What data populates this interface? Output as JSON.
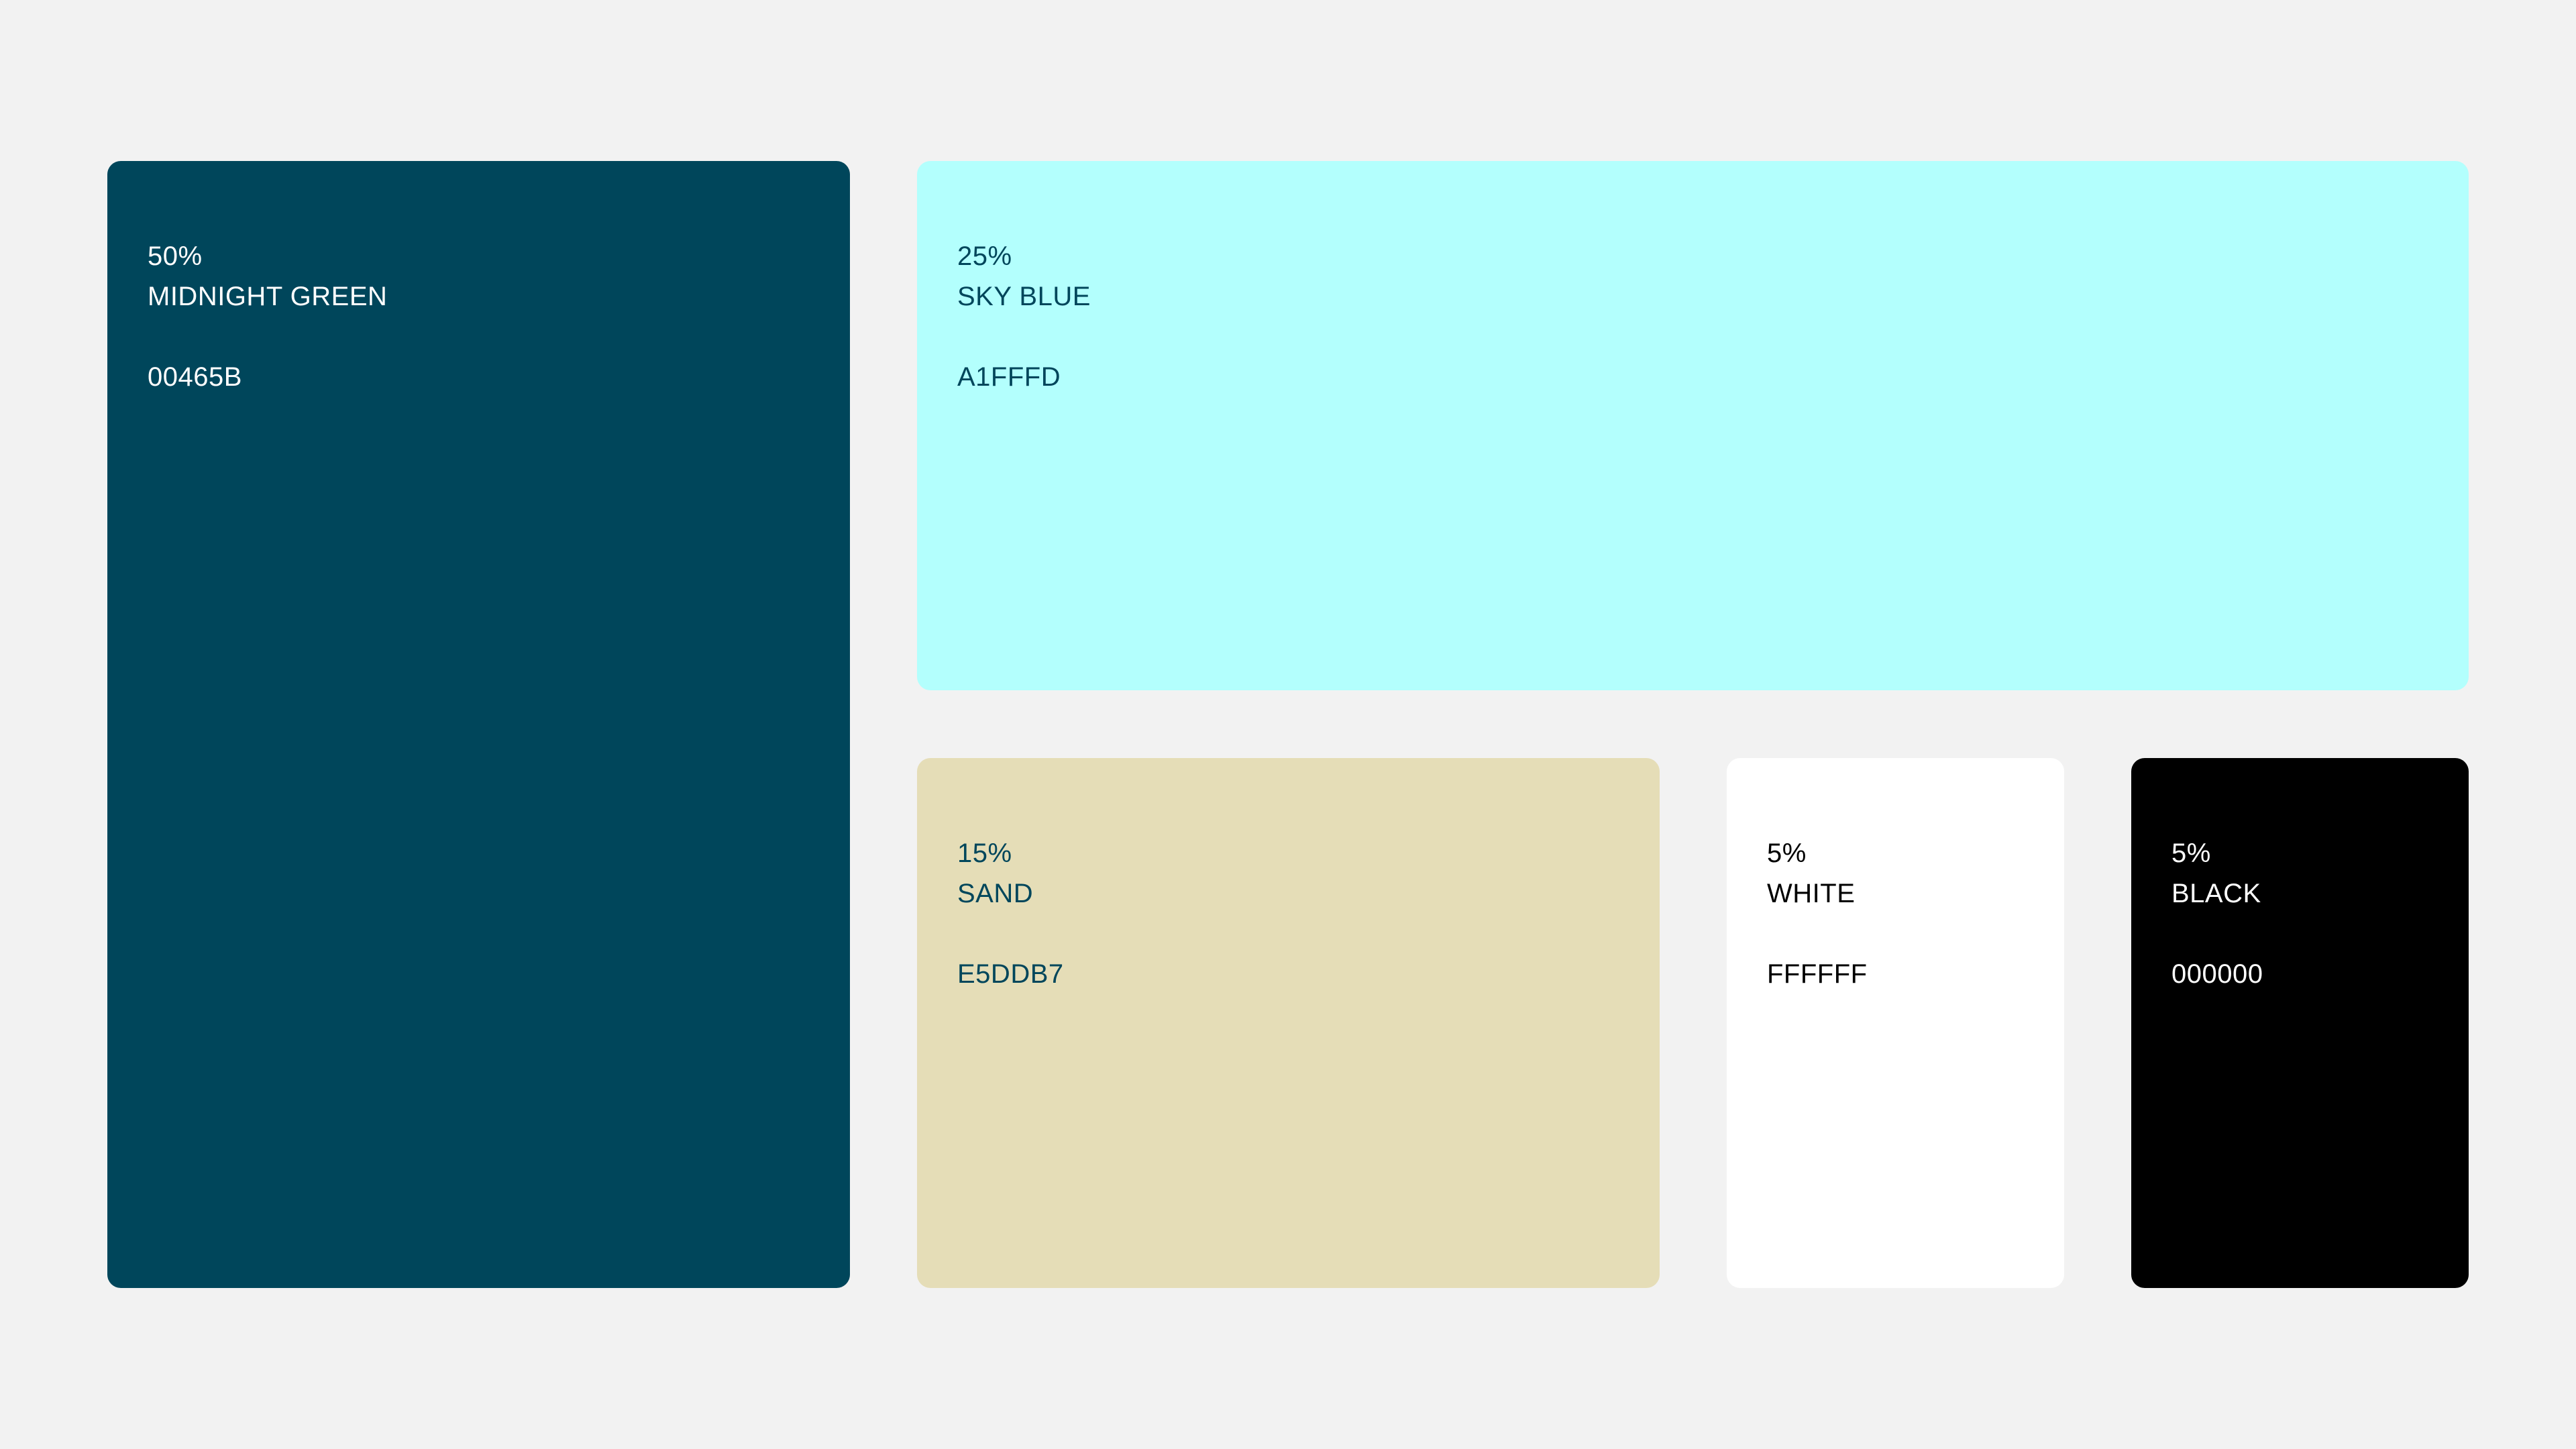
{
  "background": "#F2F2F2",
  "swatches": [
    {
      "percent": "50%",
      "name": "MIDNIGHT GREEN",
      "hex": "00465B",
      "fill": "#00465B",
      "text_color": "#FFFFFF"
    },
    {
      "percent": "25%",
      "name": "SKY BLUE",
      "hex": "A1FFFD",
      "fill": "#B3FFFD",
      "text_color": "#00465B"
    },
    {
      "percent": "15%",
      "name": "SAND",
      "hex": "E5DDB7",
      "fill": "#E5DDB7",
      "text_color": "#00465B"
    },
    {
      "percent": "5%",
      "name": "WHITE",
      "hex": "FFFFFF",
      "fill": "#FFFFFF",
      "text_color": "#000000"
    },
    {
      "percent": "5%",
      "name": "BLACK",
      "hex": "000000",
      "fill": "#000000",
      "text_color": "#FFFFFF"
    }
  ]
}
